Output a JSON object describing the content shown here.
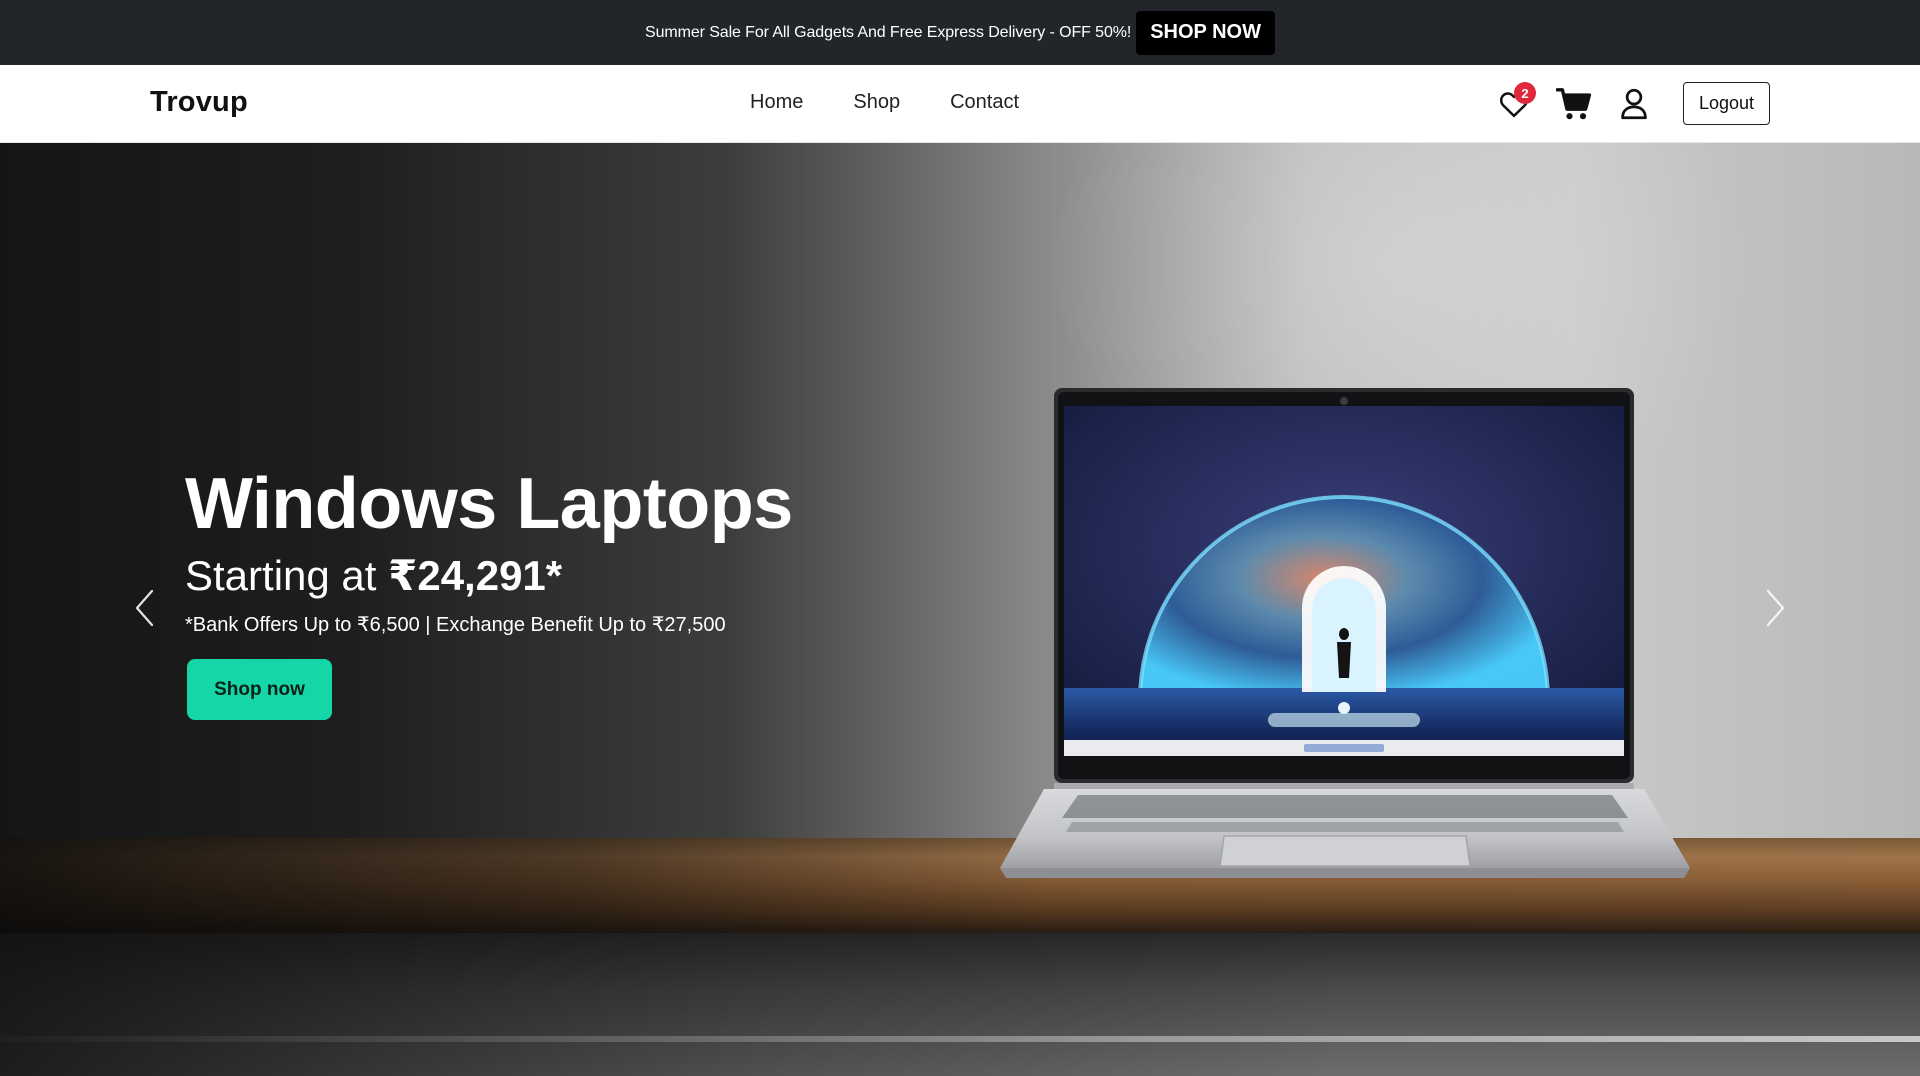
{
  "announcement": {
    "text": "Summer Sale For All Gadgets And Free Express Delivery - OFF 50%!",
    "button_label": "SHOP NOW"
  },
  "navbar": {
    "brand": "Trovup",
    "links": [
      {
        "label": "Home"
      },
      {
        "label": "Shop"
      },
      {
        "label": "Contact"
      }
    ],
    "wishlist_count": "2",
    "icons": [
      "heart-icon",
      "cart-icon",
      "user-icon"
    ],
    "logout_label": "Logout"
  },
  "hero": {
    "title": "Windows Laptops",
    "subtitle_prefix": "Starting at ",
    "price": "₹24,291*",
    "offer": "*Bank Offers Up to ₹6,500 | Exchange Benefit Up to ₹27,500",
    "button_label": "Shop now",
    "accent_color": "#15d6a6"
  },
  "colors": {
    "topbar_bg": "#22262b",
    "badge": "#e0283c"
  }
}
